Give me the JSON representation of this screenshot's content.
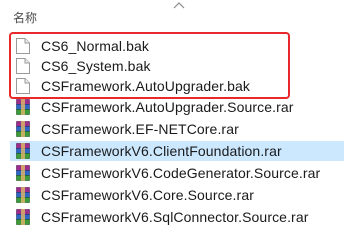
{
  "header": {
    "name_column": "名称"
  },
  "files": [
    {
      "name": "CS6_Normal.bak",
      "type": "bak",
      "selected": false
    },
    {
      "name": "CS6_System.bak",
      "type": "bak",
      "selected": false
    },
    {
      "name": "CSFramework.AutoUpgrader.bak",
      "type": "bak",
      "selected": false
    },
    {
      "name": "CSFramework.AutoUpgrader.Source.rar",
      "type": "rar",
      "selected": false
    },
    {
      "name": "CSFramework.EF-NETCore.rar",
      "type": "rar",
      "selected": false
    },
    {
      "name": "CSFrameworkV6.ClientFoundation.rar",
      "type": "rar",
      "selected": true
    },
    {
      "name": "CSFrameworkV6.CodeGenerator.Source.rar",
      "type": "rar",
      "selected": false
    },
    {
      "name": "CSFrameworkV6.Core.Source.rar",
      "type": "rar",
      "selected": false
    },
    {
      "name": "CSFrameworkV6.SqlConnector.Source.rar",
      "type": "rar",
      "selected": false
    }
  ],
  "colors": {
    "selection": "#cce8ff",
    "highlight_border": "#e8282a"
  }
}
